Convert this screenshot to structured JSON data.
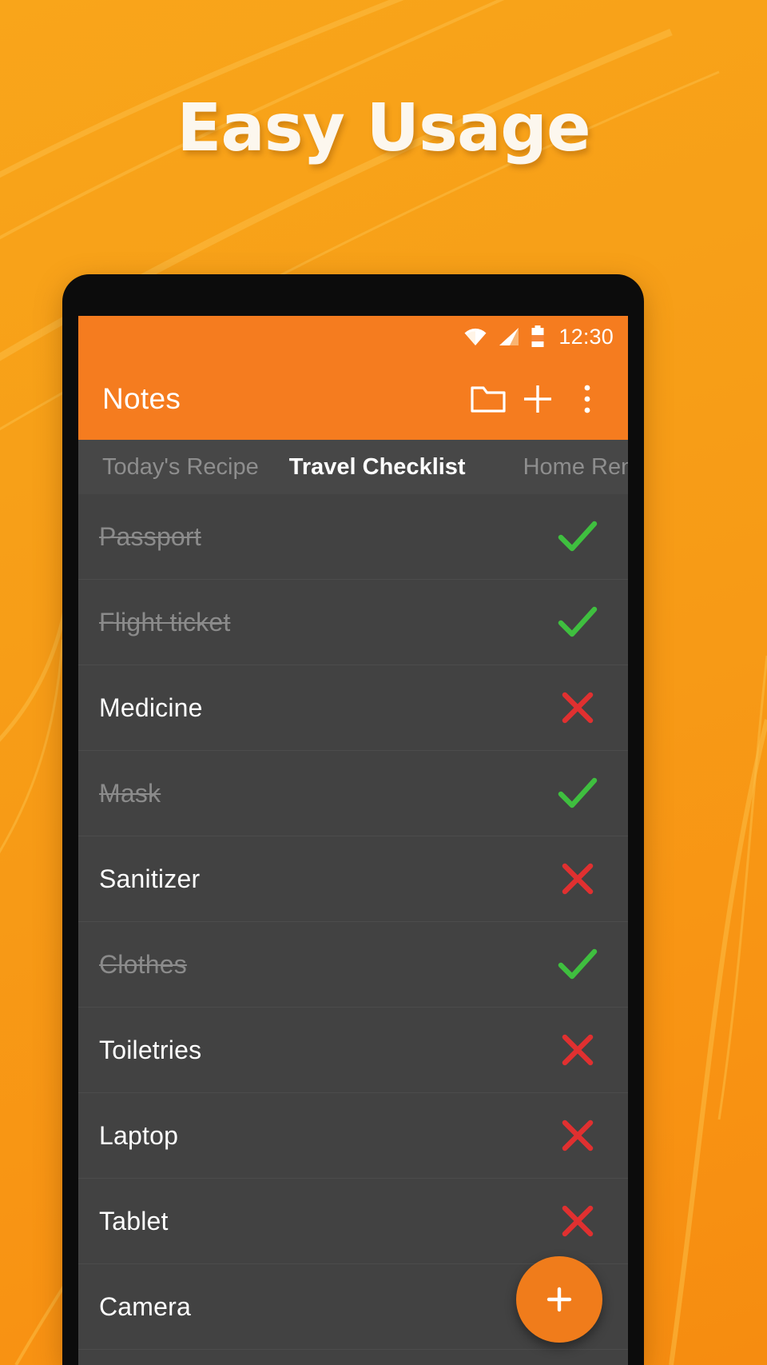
{
  "headline": "Easy Usage",
  "theme": {
    "background_top": "#F9A51A",
    "background_bottom": "#F68C10",
    "headline_color": "#FCF7EE",
    "appbar_color": "#F57C1F",
    "screen_color": "#424242",
    "tabstrip_color": "#474747",
    "accent_orange": "#F07C1B",
    "check_green": "#3FBF3F",
    "cross_red": "#E03030",
    "done_text_color": "#8B8B8B",
    "inactive_tab_color": "#8E8E8E"
  },
  "statusbar": {
    "clock": "12:30",
    "icons": [
      "wifi-icon",
      "signal-icon",
      "battery-icon"
    ]
  },
  "appbar": {
    "title": "Notes",
    "actions": [
      {
        "name": "folder-icon",
        "label": "Folder"
      },
      {
        "name": "add-icon",
        "label": "Add"
      },
      {
        "name": "overflow-menu-icon",
        "label": "More options"
      }
    ]
  },
  "tabs": [
    {
      "label": "Today's Recipe",
      "active": false
    },
    {
      "label": "Travel Checklist",
      "active": true
    },
    {
      "label": "Home Reno",
      "active": false
    }
  ],
  "checklist": {
    "items": [
      {
        "label": "Passport",
        "done": true,
        "mark": "check-icon"
      },
      {
        "label": "Flight ticket",
        "done": true,
        "mark": "check-icon"
      },
      {
        "label": "Medicine",
        "done": false,
        "mark": "cross-icon"
      },
      {
        "label": "Mask",
        "done": true,
        "mark": "check-icon"
      },
      {
        "label": "Sanitizer",
        "done": false,
        "mark": "cross-icon"
      },
      {
        "label": "Clothes",
        "done": true,
        "mark": "check-icon"
      },
      {
        "label": "Toiletries",
        "done": false,
        "mark": "cross-icon"
      },
      {
        "label": "Laptop",
        "done": false,
        "mark": "cross-icon"
      },
      {
        "label": "Tablet",
        "done": false,
        "mark": "cross-icon"
      },
      {
        "label": "Camera",
        "done": false,
        "mark": "cross-icon"
      }
    ]
  },
  "fab": {
    "name": "add-note-fab",
    "label": "+"
  }
}
